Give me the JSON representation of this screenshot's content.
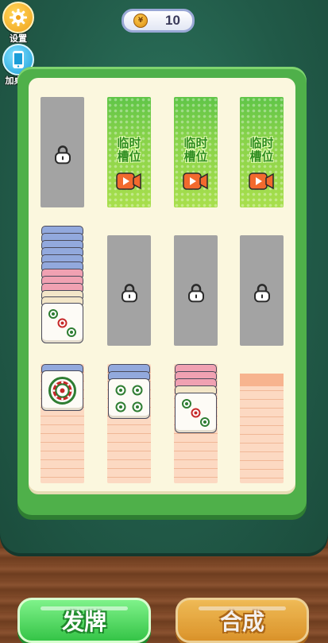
{
  "sidebar": {
    "settings_label": "设置",
    "add_table_label": "加桌面"
  },
  "coins": {
    "value": "10"
  },
  "slots": {
    "temp_label": "临时\n槽位"
  },
  "buttons": {
    "deal_label": "发牌",
    "merge_label": "合成"
  },
  "colors": {
    "felt": "#2f7a62",
    "board": "#4fb04a",
    "deal_button": "#35c447",
    "merge_button": "#e39a2b"
  }
}
